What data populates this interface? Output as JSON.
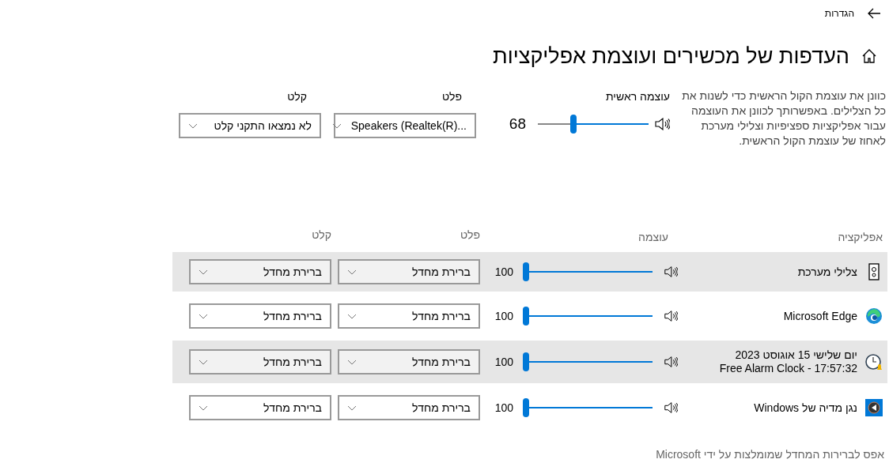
{
  "window": {
    "back_label": "הגדרות"
  },
  "title": "העדפות של מכשירים ועוצמת אפליקציות",
  "description": "כוונן את עוצמת הקול הראשית כדי לשנות את כל הצלילים. באפשרותך לכוונן את העוצמה עבור אפליקציות ספציפיות וצלילי מערכת לאחוז של עוצמת הקול הראשית.",
  "master": {
    "label": "עוצמה ראשית",
    "reading": "68"
  },
  "output": {
    "label": "פלט",
    "value": "Speakers (Realtek(R)..."
  },
  "input": {
    "label": "קלט",
    "value": "לא נמצאו התקני קלט"
  },
  "table": {
    "columns": [
      "אפליקציה",
      "עוצמה",
      "פלט",
      "קלט"
    ],
    "rows": [
      {
        "kind": "speaker",
        "name": "צלילי מערכת",
        "highlighted": true,
        "reading": "100",
        "output": "ברירת מחדל",
        "input": "ברירת מחדל"
      },
      {
        "kind": "edge",
        "name": "Microsoft Edge",
        "highlighted": false,
        "reading": "100",
        "output": "ברירת מחדל",
        "input": "ברירת מחדל"
      },
      {
        "kind": "clock",
        "name": "יום שלישי 15 אוגוסט 2023",
        "subname": "Free Alarm Clock - 17:57:32",
        "highlighted": true,
        "reading": "100",
        "output": "ברירת מחדל",
        "input": "ברירת מחדל"
      },
      {
        "kind": "media",
        "name": "נגן מדיה של Windows",
        "highlighted": false,
        "reading": "100",
        "output": "ברירת מחדל",
        "input": "ברירת מחדל"
      }
    ]
  },
  "reset_link": "אפס לברירות המחדל שמומלצות על ידי Microsoft"
}
